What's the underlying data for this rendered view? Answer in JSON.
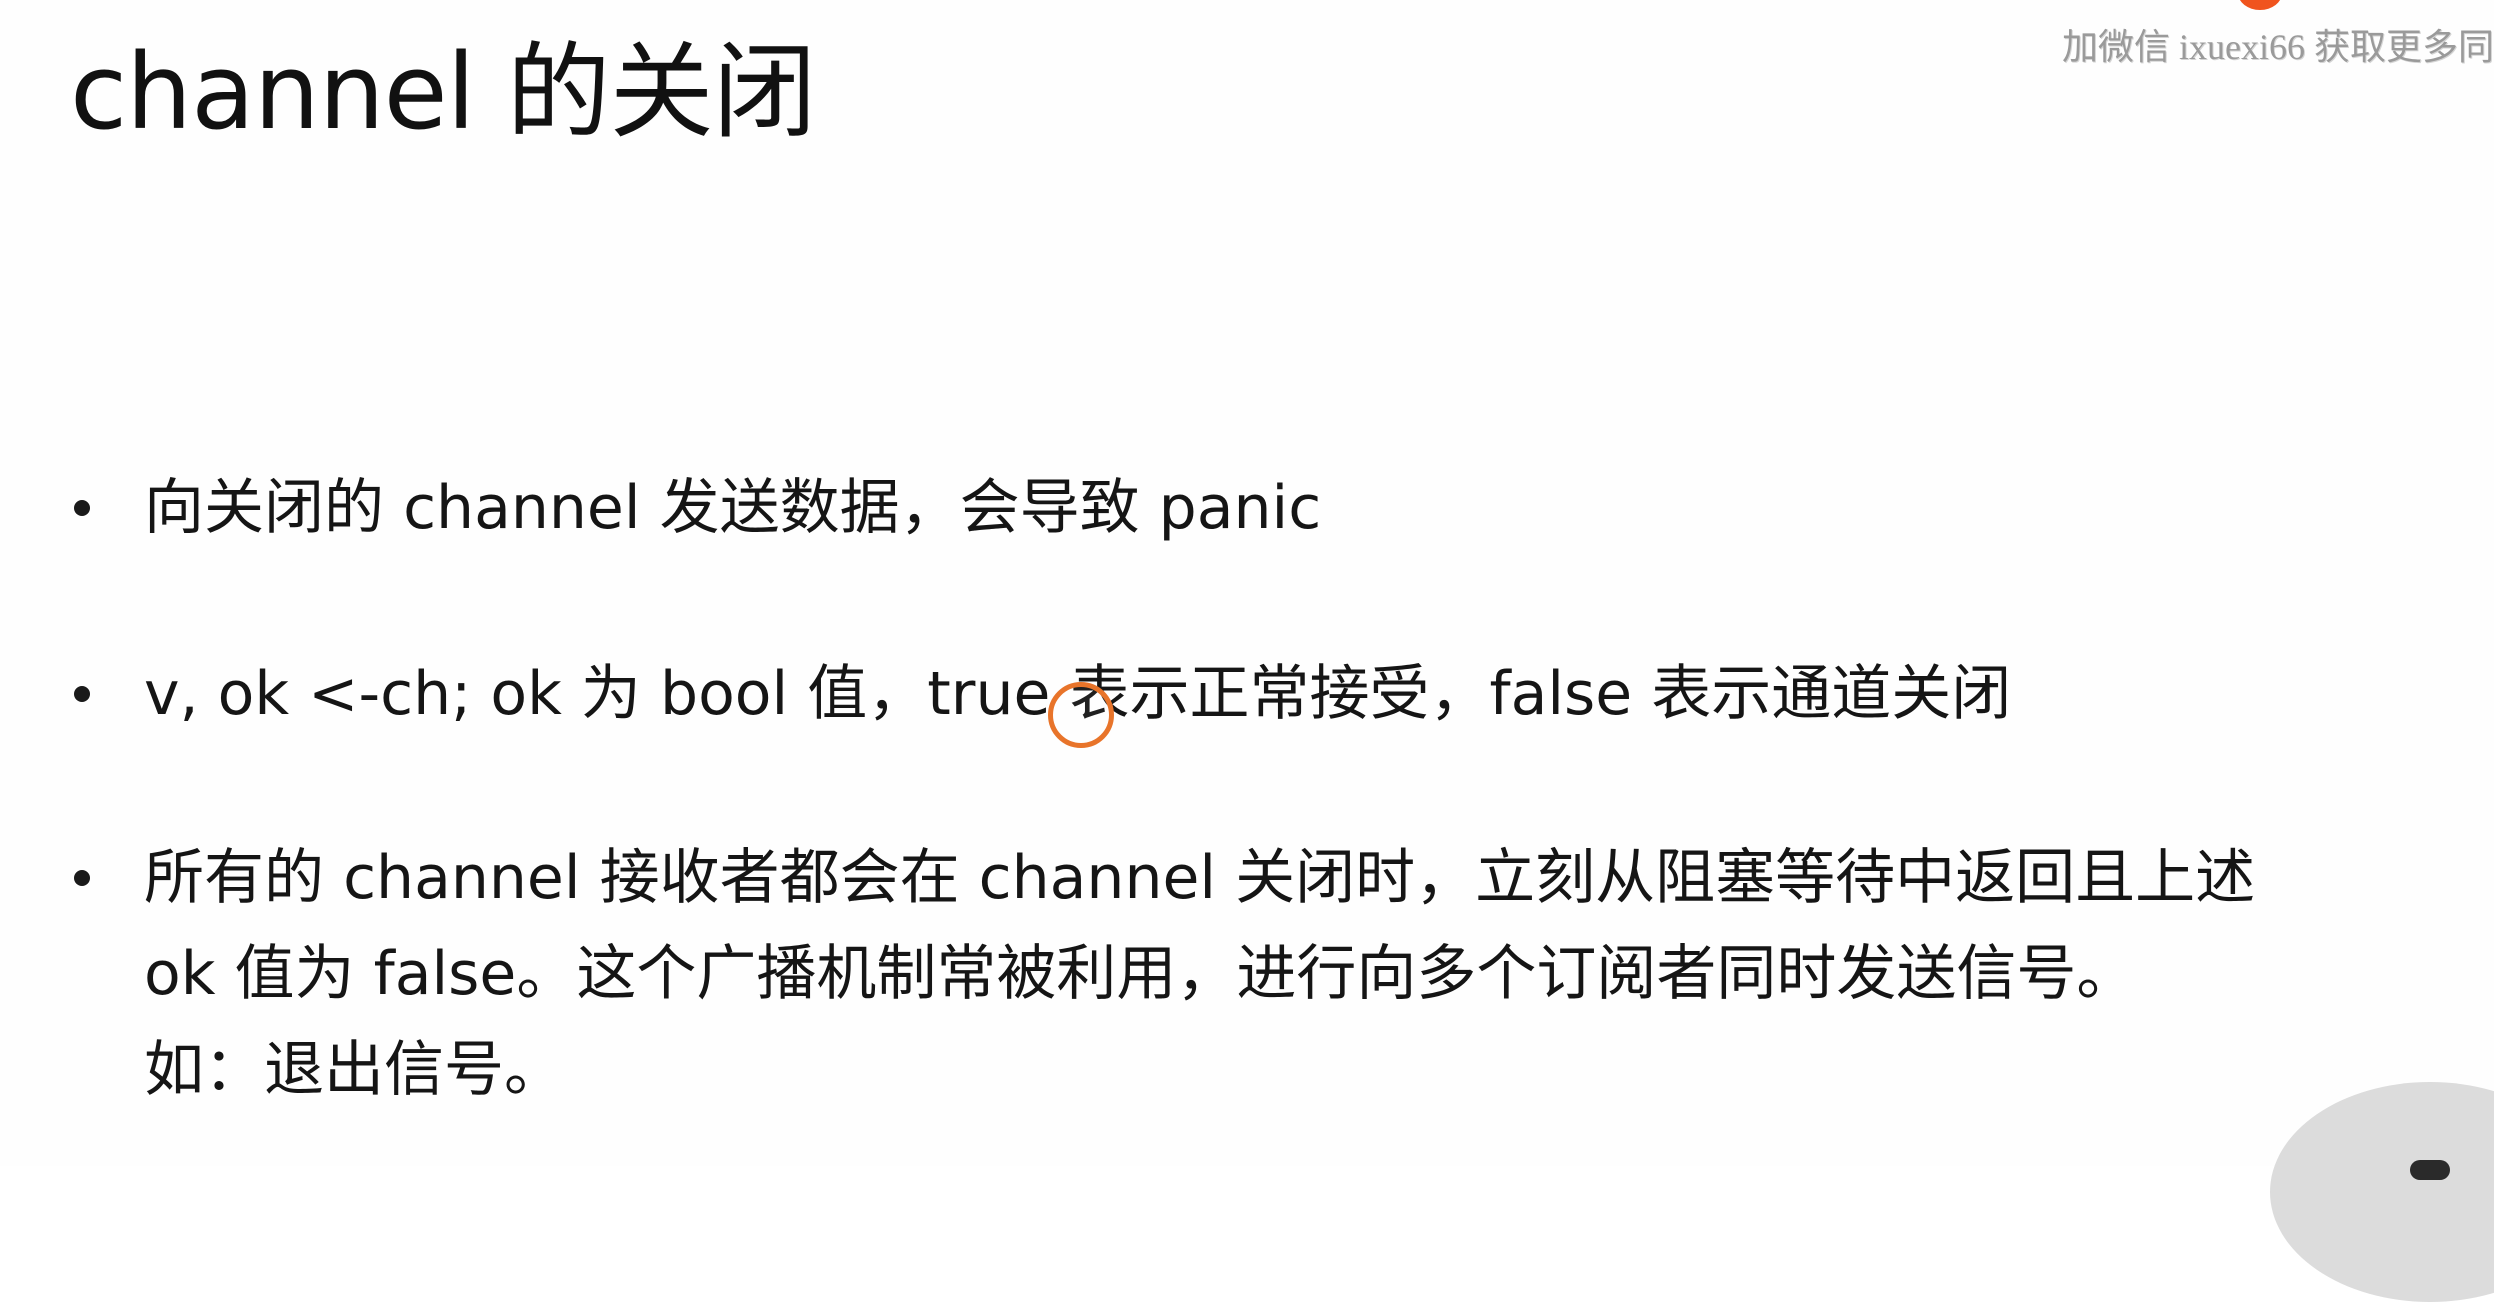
{
  "slide": {
    "title": "channel 的关闭",
    "watermark": "加微信 ixuexi66 获取更多同",
    "bullets": [
      {
        "lines": [
          "向关闭的 channel 发送数据，会导致 panic"
        ]
      },
      {
        "lines": [
          "v, ok <-ch; ok 为 bool 值，true 表示正常接受，false 表示通道关闭"
        ]
      },
      {
        "lines": [
          "所有的 channel 接收者都会在 channel 关闭时，立刻从阻塞等待中返回且上述",
          "ok 值为 false。这个广播机制常被利用，进行向多个订阅者同时发送信号。",
          "如：退出信号。"
        ]
      }
    ]
  },
  "colors": {
    "background": "#ffffff",
    "text": "#111111",
    "watermark": "#9a9a9a",
    "cursor_ring": "#e8742a",
    "accent_dot": "#f0541e"
  }
}
